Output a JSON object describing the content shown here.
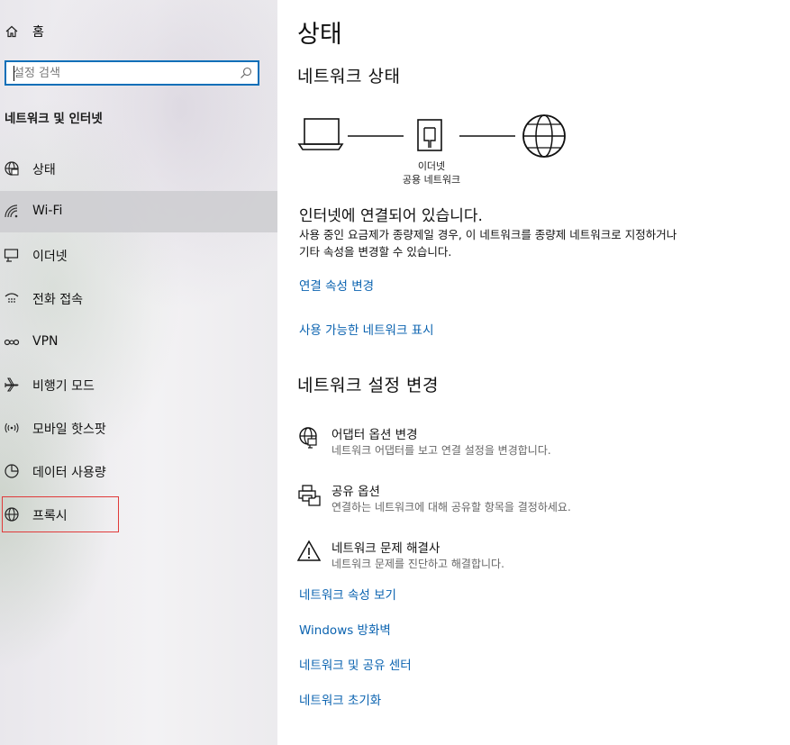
{
  "sidebar": {
    "home_label": "홈",
    "search_placeholder": "설정 검색",
    "section_title": "네트워크 및 인터넷",
    "items": [
      {
        "label": "상태",
        "icon": "home-globe-icon"
      },
      {
        "label": "Wi-Fi",
        "icon": "wifi-icon"
      },
      {
        "label": "이더넷",
        "icon": "ethernet-icon"
      },
      {
        "label": "전화 접속",
        "icon": "dialup-icon"
      },
      {
        "label": "VPN",
        "icon": "vpn-icon"
      },
      {
        "label": "비행기 모드",
        "icon": "airplane-icon"
      },
      {
        "label": "모바일 핫스팟",
        "icon": "hotspot-icon"
      },
      {
        "label": "데이터 사용량",
        "icon": "data-usage-icon"
      },
      {
        "label": "프록시",
        "icon": "globe-icon"
      }
    ],
    "selected_index": 1,
    "highlight_color": "#e03a3a"
  },
  "main": {
    "page_title": "상태",
    "network_status_heading": "네트워크 상태",
    "diagram": {
      "adapter_label": "이더넷",
      "network_label": "공용 네트워크"
    },
    "status_main": "인터넷에 연결되어 있습니다.",
    "status_desc": "사용 중인 요금제가 종량제일 경우, 이 네트워크를 종량제 네트워크로 지정하거나 기타 속성을 변경할 수 있습니다.",
    "links_top": [
      "연결 속성 변경",
      "사용 가능한 네트워크 표시"
    ],
    "settings_heading": "네트워크 설정 변경",
    "options": [
      {
        "title": "어댑터 옵션 변경",
        "desc": "네트워크 어댑터를 보고 연결 설정을 변경합니다.",
        "icon": "adapter-globe-icon"
      },
      {
        "title": "공유 옵션",
        "desc": "연결하는 네트워크에 대해 공유할 항목을 결정하세요.",
        "icon": "sharing-printer-icon"
      },
      {
        "title": "네트워크 문제 해결사",
        "desc": "네트워크 문제를 진단하고 해결합니다.",
        "icon": "warning-icon"
      }
    ],
    "links_bottom": [
      "네트워크 속성 보기",
      "Windows 방화벽",
      "네트워크 및 공유 센터",
      "네트워크 초기화"
    ],
    "link_color": "#0b63b0"
  }
}
